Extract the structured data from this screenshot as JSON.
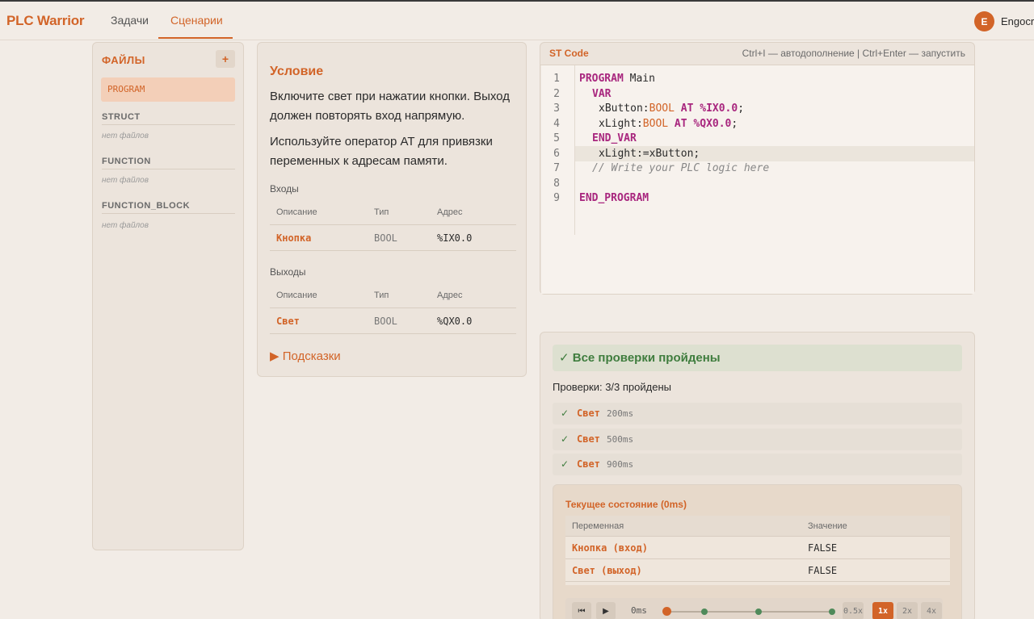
{
  "colors": {
    "accent": "#d26428",
    "success": "#3f7d3e",
    "background": "#f2ece6"
  },
  "header": {
    "logo": "PLC Warrior",
    "tabs": [
      {
        "label": "Задачи",
        "active": false
      },
      {
        "label": "Сценарии",
        "active": true
      }
    ],
    "user": {
      "initial": "E",
      "name": "Engocr"
    }
  },
  "files": {
    "title": "ФАЙЛЫ",
    "add_label": "+",
    "program_item": "PROGRAM",
    "sections": [
      {
        "title": "STRUCT",
        "empty": "нет файлов"
      },
      {
        "title": "FUNCTION",
        "empty": "нет файлов"
      },
      {
        "title": "FUNCTION_BLOCK",
        "empty": "нет файлов"
      }
    ]
  },
  "condition": {
    "title": "Условие",
    "paragraphs": [
      "Включите свет при нажатии кнопки. Выход должен повторять вход напрямую.",
      "Используйте оператор AT для привязки переменных к адресам памяти."
    ],
    "inputs_title": "Входы",
    "outputs_title": "Выходы",
    "columns": [
      "Описание",
      "Тип",
      "Адрес"
    ],
    "inputs": [
      {
        "name": "Кнопка",
        "type": "BOOL",
        "address": "%IX0.0"
      }
    ],
    "outputs": [
      {
        "name": "Свет",
        "type": "BOOL",
        "address": "%QX0.0"
      }
    ],
    "hints_label": "▶ Подсказки"
  },
  "code": {
    "title": "ST Code",
    "hint": "Ctrl+I — автодополнение | Ctrl+Enter — запустить",
    "line_numbers": [
      "1",
      "2",
      "3",
      "4",
      "5",
      "6",
      "7",
      "8",
      "9"
    ],
    "highlighted_line": 6,
    "tokens": {
      "l1_kw": "PROGRAM",
      "l1_rest": " Main",
      "l2_kw": "VAR",
      "l3_var": "xButton:",
      "l3_type": "BOOL",
      "l3_at": " AT ",
      "l3_addr": "%IX0.0",
      "l3_end": ";",
      "l4_var": "xLight:",
      "l4_type": "BOOL",
      "l4_at": " AT ",
      "l4_addr": "%QX0.0",
      "l4_end": ";",
      "l5_kw": "END_VAR",
      "l6": "xLight:=xButton;",
      "l7": "// Write your PLC logic here",
      "l9_kw": "END_PROGRAM"
    }
  },
  "result": {
    "banner": "✓ Все проверки пройдены",
    "summary": "Проверки: 3/3 пройдены",
    "checks": [
      {
        "mark": "✓",
        "name": "Свет",
        "time": "200ms"
      },
      {
        "mark": "✓",
        "name": "Свет",
        "time": "500ms"
      },
      {
        "mark": "✓",
        "name": "Свет",
        "time": "900ms"
      }
    ],
    "state": {
      "title": "Текущее состояние (0ms)",
      "columns": [
        "Переменная",
        "Значение"
      ],
      "rows": [
        {
          "name": "Кнопка (вход)",
          "value": "FALSE"
        },
        {
          "name": "Свет (выход)",
          "value": "FALSE"
        }
      ]
    },
    "player": {
      "rewind_icon": "⏮",
      "play_icon": "▶",
      "time": "0ms",
      "position": 0,
      "speeds": [
        {
          "label": "0.5x",
          "active": false
        },
        {
          "label": "1x",
          "active": true
        },
        {
          "label": "2x",
          "active": false
        },
        {
          "label": "4x",
          "active": false
        }
      ]
    }
  }
}
